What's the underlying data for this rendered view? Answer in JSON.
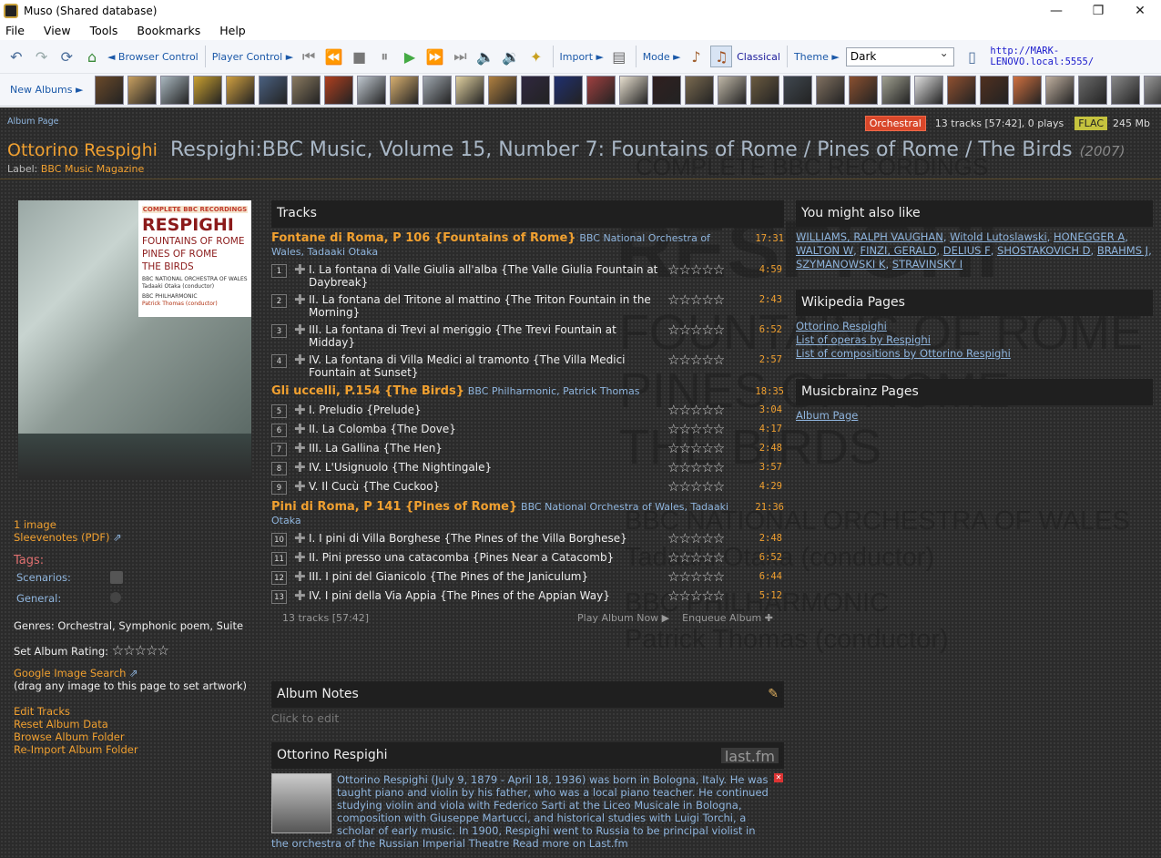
{
  "window": {
    "title": "Muso (Shared database)",
    "minimize": "—",
    "maximize": "❐",
    "close": "✕"
  },
  "menu": [
    "File",
    "View",
    "Tools",
    "Bookmarks",
    "Help"
  ],
  "toolbar": {
    "browser_control": "◄ Browser Control",
    "player_control": "Player Control ►",
    "import": "Import ►",
    "mode": "Mode ►",
    "classical": "Classical",
    "theme": "Theme ►",
    "theme_value": "Dark",
    "url": "http://MARK-LENOVO.local:5555/",
    "new_albums": "New Albums ►"
  },
  "album_page_link": "Album Page",
  "stats": {
    "genre_badge": "Orchestral",
    "summary": "13 tracks [57:42], 0 plays",
    "format": "FLAC",
    "size": "245 Mb"
  },
  "composer": "Ottorino Respighi",
  "album_title": "Respighi:BBC Music, Volume 15, Number 7: Fountains of Rome / Pines of Rome / The Birds",
  "year": "(2007)",
  "label_prefix": "Label:",
  "label": "BBC Music Magazine",
  "cover": {
    "tag": "COMPLETE BBC RECORDINGS",
    "name": "RESPIGHI",
    "line1": "FOUNTAINS OF ROME",
    "line2": "PINES OF ROME",
    "line3": "THE BIRDS",
    "credit1": "BBC NATIONAL ORCHESTRA OF WALES",
    "credit2": "Tadaaki Otaka (conductor)",
    "credit3": "BBC PHILHARMONIC",
    "credit4": "Patrick Thomas (conductor)"
  },
  "left": {
    "images": "1 image",
    "sleevenotes": "Sleevenotes (PDF)",
    "tags": "Tags:",
    "scenarios": "Scenarios:",
    "general": "General:",
    "genres": "Genres: Orchestral, Symphonic poem, Suite",
    "set_rating": "Set Album Rating:",
    "google": "Google Image Search",
    "drag_hint": "(drag any image to this page to set artwork)",
    "edit_tracks": "Edit Tracks",
    "reset_data": "Reset Album Data",
    "browse_folder": "Browse Album Folder",
    "reimport": "Re-Import Album Folder"
  },
  "tracks_heading": "Tracks",
  "works": [
    {
      "title": "Fontane di Roma, P 106 {Fountains of Rome}",
      "orchestra": "BBC National Orchestra of Wales",
      "conductor": "Tadaaki Otaka",
      "time": "17:31",
      "tracks": [
        {
          "n": "1",
          "name": "I. La fontana di Valle Giulia all'alba {The Valle Giulia Fountain at Daybreak}",
          "time": "4:59"
        },
        {
          "n": "2",
          "name": "II. La fontana del Tritone al mattino {The Triton Fountain in the Morning}",
          "time": "2:43"
        },
        {
          "n": "3",
          "name": "III. La fontana di Trevi al meriggio {The Trevi Fountain at Midday}",
          "time": "6:52"
        },
        {
          "n": "4",
          "name": "IV. La fontana di Villa Medici al tramonto {The Villa Medici Fountain at Sunset}",
          "time": "2:57"
        }
      ]
    },
    {
      "title": "Gli uccelli, P.154 {The Birds}",
      "orchestra": "BBC Philharmonic",
      "conductor": "Patrick Thomas",
      "time": "18:35",
      "tracks": [
        {
          "n": "5",
          "name": "I. Preludio {Prelude}",
          "time": "3:04"
        },
        {
          "n": "6",
          "name": "II. La Colomba {The Dove}",
          "time": "4:17"
        },
        {
          "n": "7",
          "name": "III. La Gallina {The Hen}",
          "time": "2:48"
        },
        {
          "n": "8",
          "name": "IV. L'Usignuolo {The Nightingale}",
          "time": "3:57"
        },
        {
          "n": "9",
          "name": "V. Il Cucù {The Cuckoo}",
          "time": "4:29"
        }
      ]
    },
    {
      "title": "Pini di Roma, P 141 {Pines of Rome}",
      "orchestra": "BBC National Orchestra of Wales",
      "conductor": "Tadaaki Otaka",
      "time": "21:36",
      "tracks": [
        {
          "n": "10",
          "name": "I. I pini di Villa Borghese {The Pines of the Villa Borghese}",
          "time": "2:48"
        },
        {
          "n": "11",
          "name": "II. Pini presso una catacomba {Pines Near a Catacomb}",
          "time": "6:52"
        },
        {
          "n": "12",
          "name": "III. I pini del Gianicolo {The Pines of the Janiculum}",
          "time": "6:44"
        },
        {
          "n": "13",
          "name": "IV. I pini della Via Appia {The Pines of the Appian Way}",
          "time": "5:12"
        }
      ]
    }
  ],
  "tracks_footer": {
    "summary": "13 tracks [57:42]",
    "play": "Play Album Now",
    "enqueue": "Enqueue Album"
  },
  "album_notes": {
    "heading": "Album Notes",
    "click": "Click to edit"
  },
  "bio": {
    "heading": "Ottorino Respighi",
    "lastfm": "last.fm",
    "text": "Ottorino Respighi (July 9, 1879 - April 18, 1936) was born in Bologna, Italy. He was taught piano and violin by his father, who was a local piano teacher. He continued studying violin and viola with Federico Sarti at the Liceo Musicale in Bologna, composition with Giuseppe Martucci, and historical studies with Luigi Torchi, a scholar of early music. In 1900, Respighi went to Russia to be principal violist in the orchestra of the Russian Imperial Theatre",
    "more": "Read more on Last.fm"
  },
  "you_might": {
    "heading": "You might also like",
    "items": [
      "WILLIAMS, RALPH VAUGHAN",
      "Witold Lutoslawski",
      "HONEGGER A",
      "WALTON W",
      "FINZI, GERALD",
      "DELIUS F",
      "SHOSTAKOVICH D",
      "BRAHMS J",
      "SZYMANOWSKI K",
      "STRAVINSKY I"
    ]
  },
  "wikipedia": {
    "heading": "Wikipedia Pages",
    "items": [
      "Ottorino Respighi",
      "List of operas by Respighi",
      "List of compositions by Ottorino Respighi"
    ]
  },
  "musicbrainz": {
    "heading": "Musicbrainz Pages",
    "items": [
      "Album Page"
    ]
  },
  "background_text": {
    "l1": "COMPLETE BBC RECORDINGS",
    "l2": "RESPIGHI",
    "l3": "FOUNTAINS OF ROME",
    "l4": "PINES OF ROME",
    "l5": "THE BIRDS",
    "l6": "BBC NATIONAL ORCHESTRA OF WALES",
    "l7": "Tadaaki Otaka (conductor)",
    "l8": "BBC PHILHARMONIC",
    "l9": "Patrick Thomas (conductor)"
  },
  "thumb_colors": [
    "#6b4a2a",
    "#c8a060",
    "#aab8c0",
    "#c9a030",
    "#d0a040",
    "#4a6080",
    "#8a7a60",
    "#b04020",
    "#c0c8d0",
    "#d8b070",
    "#a0a8b0",
    "#e0d0a0",
    "#b08040",
    "#302840",
    "#203070",
    "#a04040",
    "#e8e0d0",
    "#302020",
    "#7a6a50",
    "#c0b8a8",
    "#6a5a40",
    "#404850",
    "#807060",
    "#8a5030",
    "#a0a090",
    "#e0e0e0",
    "#905030",
    "#503020",
    "#d07040",
    "#c0b0a0",
    "#6a6a6a",
    "#888888",
    "#999999",
    "#aaaaaa"
  ],
  "colors": {
    "accent": "#f0a030",
    "link": "#8fb5de",
    "background": "#2b2b2b"
  }
}
